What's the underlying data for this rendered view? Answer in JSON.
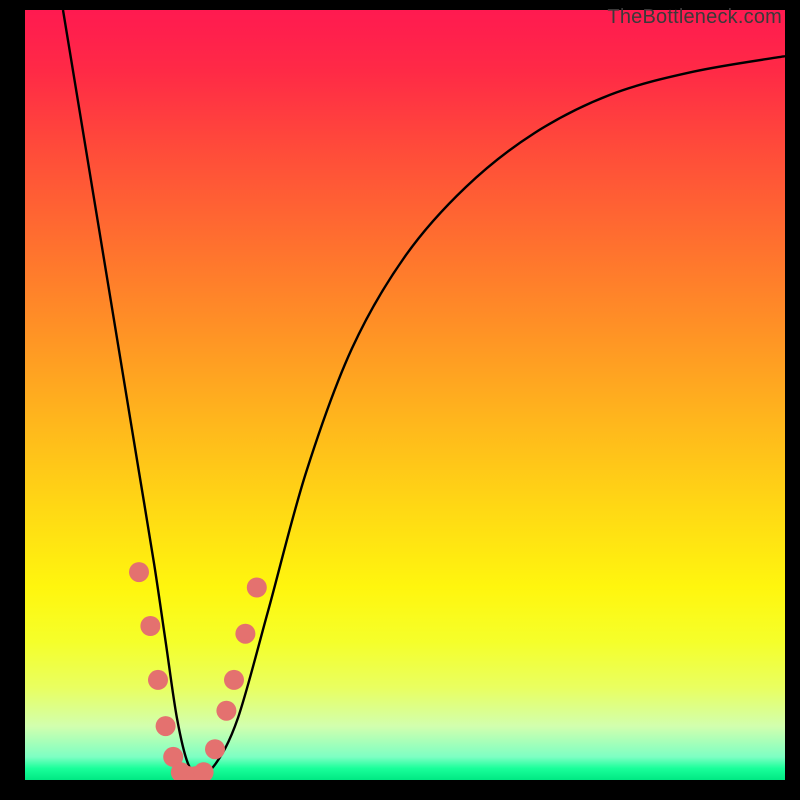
{
  "watermark": "TheBottleneck.com",
  "chart_data": {
    "type": "line",
    "title": "",
    "xlabel": "",
    "ylabel": "",
    "xlim": [
      0,
      100
    ],
    "ylim": [
      0,
      100
    ],
    "series": [
      {
        "name": "bottleneck-curve",
        "x": [
          5,
          7,
          9,
          11,
          13,
          15,
          17,
          18.5,
          20,
          21.5,
          23,
          25,
          28,
          32,
          37,
          43,
          50,
          58,
          67,
          77,
          88,
          100
        ],
        "values": [
          100,
          88,
          76,
          64,
          52,
          40,
          28,
          18,
          8,
          2,
          1,
          2,
          8,
          22,
          40,
          56,
          68,
          77,
          84,
          89,
          92,
          94
        ]
      }
    ],
    "markers": {
      "name": "highlight-dots",
      "style": "circle",
      "color": "#e4716f",
      "radius": 10,
      "points": [
        {
          "x": 15.0,
          "y": 27
        },
        {
          "x": 16.5,
          "y": 20
        },
        {
          "x": 17.5,
          "y": 13
        },
        {
          "x": 18.5,
          "y": 7
        },
        {
          "x": 19.5,
          "y": 3
        },
        {
          "x": 20.5,
          "y": 1
        },
        {
          "x": 21.5,
          "y": 0.5
        },
        {
          "x": 22.5,
          "y": 0.5
        },
        {
          "x": 23.5,
          "y": 1
        },
        {
          "x": 25.0,
          "y": 4
        },
        {
          "x": 26.5,
          "y": 9
        },
        {
          "x": 27.5,
          "y": 13
        },
        {
          "x": 29.0,
          "y": 19
        },
        {
          "x": 30.5,
          "y": 25
        }
      ]
    },
    "gradient_bands": [
      {
        "color": "#ff1a50",
        "stop": 0
      },
      {
        "color": "#ff9325",
        "stop": 42
      },
      {
        "color": "#fff60e",
        "stop": 75
      },
      {
        "color": "#00e883",
        "stop": 100
      }
    ]
  }
}
